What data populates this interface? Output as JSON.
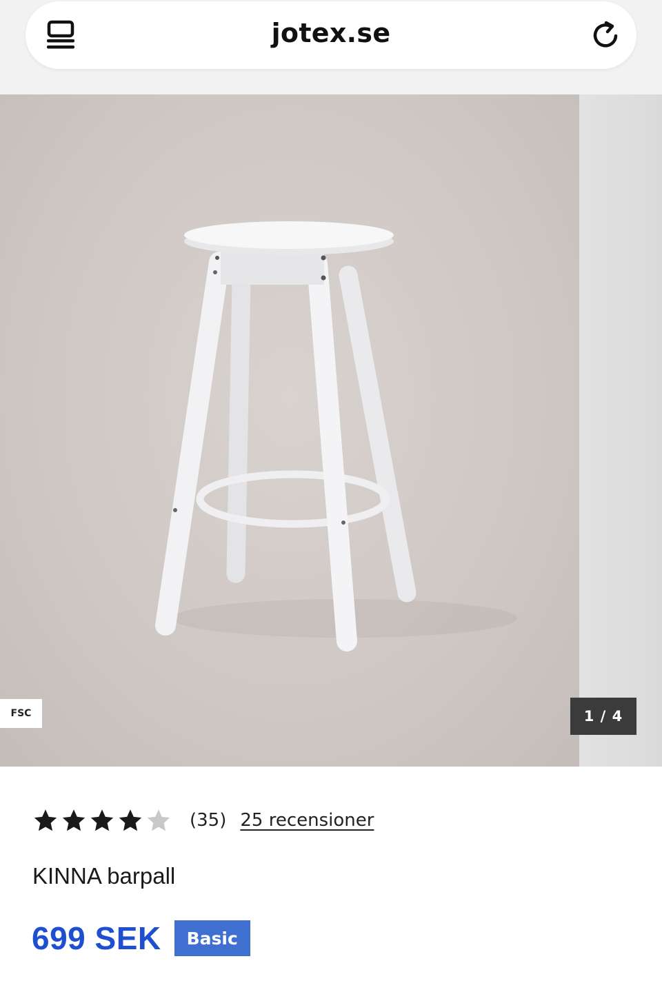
{
  "browser": {
    "url": "jotex.se",
    "icons": {
      "menu": "tabs-menu-icon",
      "reload": "reload-icon"
    }
  },
  "gallery": {
    "badge": "FSC",
    "counter": "1 / 4",
    "image": "bar-stool-photo"
  },
  "product": {
    "rating": {
      "value": 4,
      "max": 5,
      "count": "(35)",
      "reviews_link": "25 recensioner"
    },
    "name": "KINNA barpall",
    "price": "699 SEK",
    "price_badge": "Basic"
  },
  "colors": {
    "price": "#1f4fd1",
    "badge_bg": "#3f6fd1",
    "star_filled": "#1a1a1a",
    "star_empty": "#c8c8c8",
    "counter_bg": "#3b3b3b"
  }
}
